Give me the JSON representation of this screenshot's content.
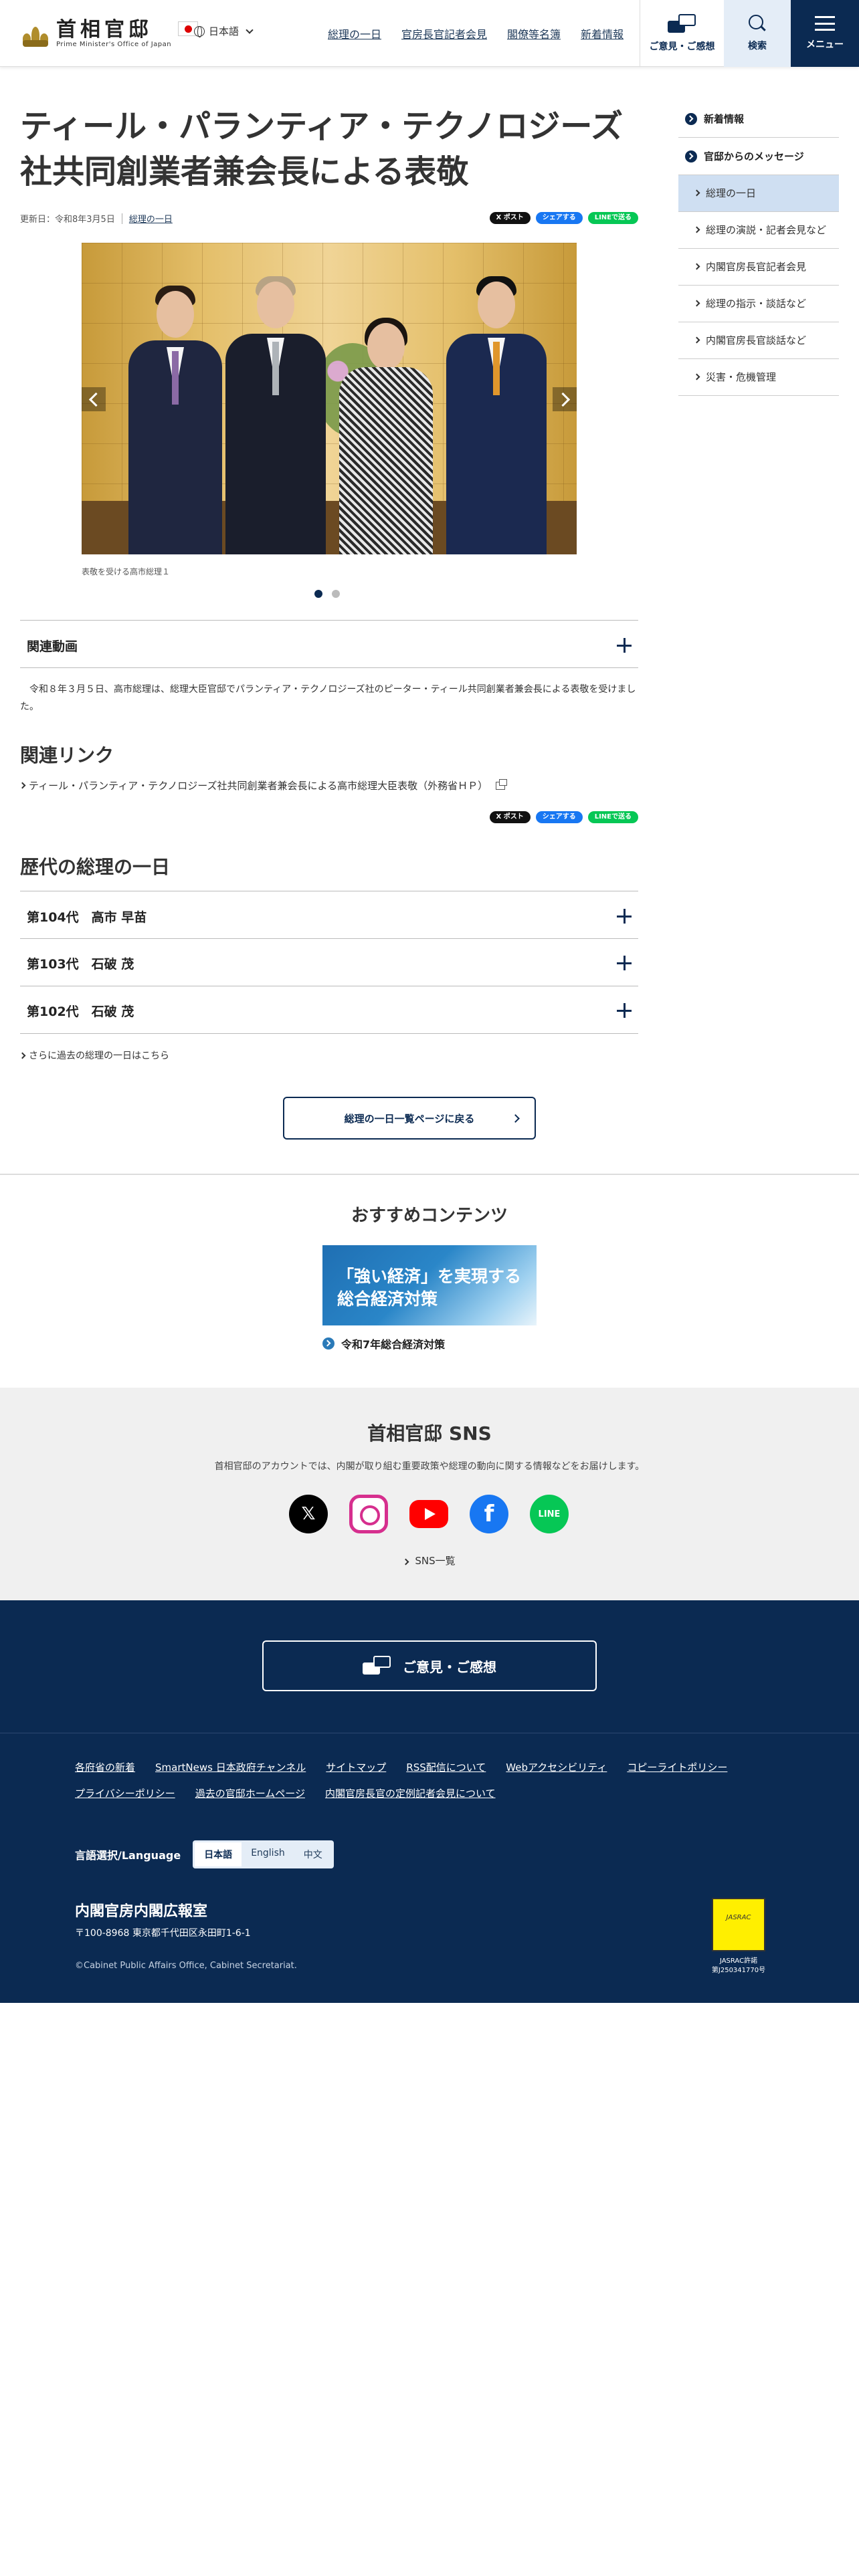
{
  "header": {
    "logo_jp": "首相官邸",
    "logo_en": "Prime Minister's Office of Japan",
    "lang": "日本語",
    "nav": [
      "総理の一日",
      "官房長官記者会見",
      "閣僚等名簿",
      "新着情報"
    ],
    "opinion": "ご意見・ご感想",
    "search": "検索",
    "menu": "メニュー"
  },
  "article": {
    "title": "ティール・パランティア・テクノロジーズ社共同創業者兼会長による表敬",
    "updated": "更新日：令和8年3月5日",
    "category": "総理の一日",
    "share": {
      "x": "X ポスト",
      "fb": "シェアする",
      "line": "LINEで送る"
    },
    "caption": "表敬を受ける高市総理１",
    "related_video": "関連動画",
    "body": "令和８年３月５日、高市総理は、総理大臣官邸でパランティア・テクノロジーズ社のピーター・ティール共同創業者兼会長による表敬を受けました。",
    "related_links_title": "関連リンク",
    "related_link": "ティール・パランティア・テクノロジーズ社共同創業者兼会長による高市総理大臣表敬（外務省ＨＰ）",
    "history_title": "歴代の総理の一日",
    "history": [
      {
        "label": "第104代　高市 早苗"
      },
      {
        "label": "第103代　石破 茂"
      },
      {
        "label": "第102代　石破 茂"
      }
    ],
    "more_link": "さらに過去の総理の一日はこちら",
    "back_button": "総理の一日一覧ページに戻る"
  },
  "sidebar": {
    "new": "新着情報",
    "messages": "官邸からのメッセージ",
    "items": [
      "総理の一日",
      "総理の演説・記者会見など",
      "内閣官房長官記者会見",
      "総理の指示・談話など",
      "内閣官房長官談話など",
      "災害・危機管理"
    ]
  },
  "recommend": {
    "title": "おすすめコンテンツ",
    "banner": "「強い経済」を実現する\n総合経済対策",
    "link": "令和7年総合経済対策"
  },
  "sns": {
    "title": "首相官邸 SNS",
    "desc": "首相官邸のアカウントでは、内閣が取り組む重要政策や総理の動向に関する情報などをお届けします。",
    "icons": [
      "x-icon",
      "instagram-icon",
      "youtube-icon",
      "facebook-icon",
      "line-icon"
    ],
    "line_label": "LINE",
    "fb_label": "f",
    "x_label": "𝕏",
    "list": "SNS一覧"
  },
  "opinion_bar": {
    "label": "ご意見・ご感想"
  },
  "footer": {
    "links": [
      "各府省の新着",
      "SmartNews 日本政府チャンネル",
      "サイトマップ",
      "RSS配信について",
      "Webアクセシビリティ",
      "コピーライトポリシー",
      "プライバシーポリシー",
      "過去の官邸ホームページ",
      "内閣官房長官の定例記者会見について"
    ],
    "lang_label": "言語選択/Language",
    "langs": [
      "日本語",
      "English",
      "中文"
    ],
    "org": "内閣官房内閣広報室",
    "address": "〒100-8968 東京都千代田区永田町1-6-1",
    "copyright": "©Cabinet Public Affairs Office, Cabinet Secretariat.",
    "jasrac_logo": "JASRAC",
    "jasrac1": "JASRAC許諾",
    "jasrac2": "第J250341770号"
  },
  "colors": {
    "primary": "#0b2a52",
    "sidebar_active": "#cfdff2",
    "sns_bg": "#f0f0f0"
  }
}
